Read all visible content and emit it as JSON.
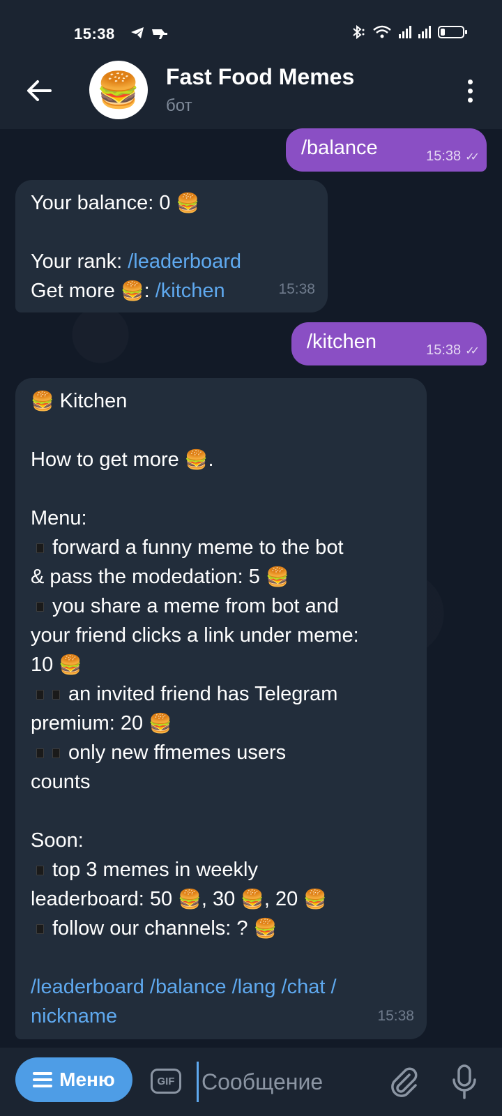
{
  "status_bar": {
    "time": "15:38",
    "left_icons": "◢ ✈"
  },
  "header": {
    "title": "Fast Food Memes",
    "subtitle": "бот",
    "avatar_emoji": "🍔"
  },
  "messages": {
    "out1": {
      "text": "/balance",
      "time": "15:38"
    },
    "in1": {
      "balance_label": "Your balance: 0 ",
      "rank_label": "Your rank: ",
      "rank_link": "/leaderboard",
      "more_label": "Get more ",
      "more_sep": ": ",
      "more_link": "/kitchen",
      "time": "15:38"
    },
    "out2": {
      "text": "/kitchen",
      "time": "15:38"
    },
    "in2": {
      "title": " Kitchen",
      "intro": "How to get more ",
      "intro_end": ".",
      "menu_label": "Menu:",
      "item1_a": "forward a funny meme to the bot",
      "item1_b": "& pass the modedation: 5 ",
      "item2_a": "you share a meme from bot and",
      "item2_b": "your friend clicks a link under meme:",
      "item2_c": "10 ",
      "item3_a": "an invited friend has Telegram",
      "item3_b": "premium: 20 ",
      "item4_a": "only new ffmemes users",
      "item4_b": "counts",
      "soon_label": "Soon:",
      "soon1_a": "top 3 memes in weekly",
      "soon1_b": "leaderboard: 50 ",
      "soon1_c": ", 30 ",
      "soon1_d": ", 20 ",
      "soon2": "follow our channels: ? ",
      "links_line1": "/leaderboard /balance /lang /chat /",
      "links_line2": "nickname",
      "time": "15:38"
    }
  },
  "emoji": {
    "burger": "🍔"
  },
  "composer": {
    "menu_label": "Меню",
    "gif_label": "GIF",
    "placeholder": "Сообщение"
  },
  "colors": {
    "outgoing": "#8a4fc4",
    "incoming": "#222d3b",
    "link": "#5fa9ef",
    "menu_button": "#4e9de6"
  }
}
